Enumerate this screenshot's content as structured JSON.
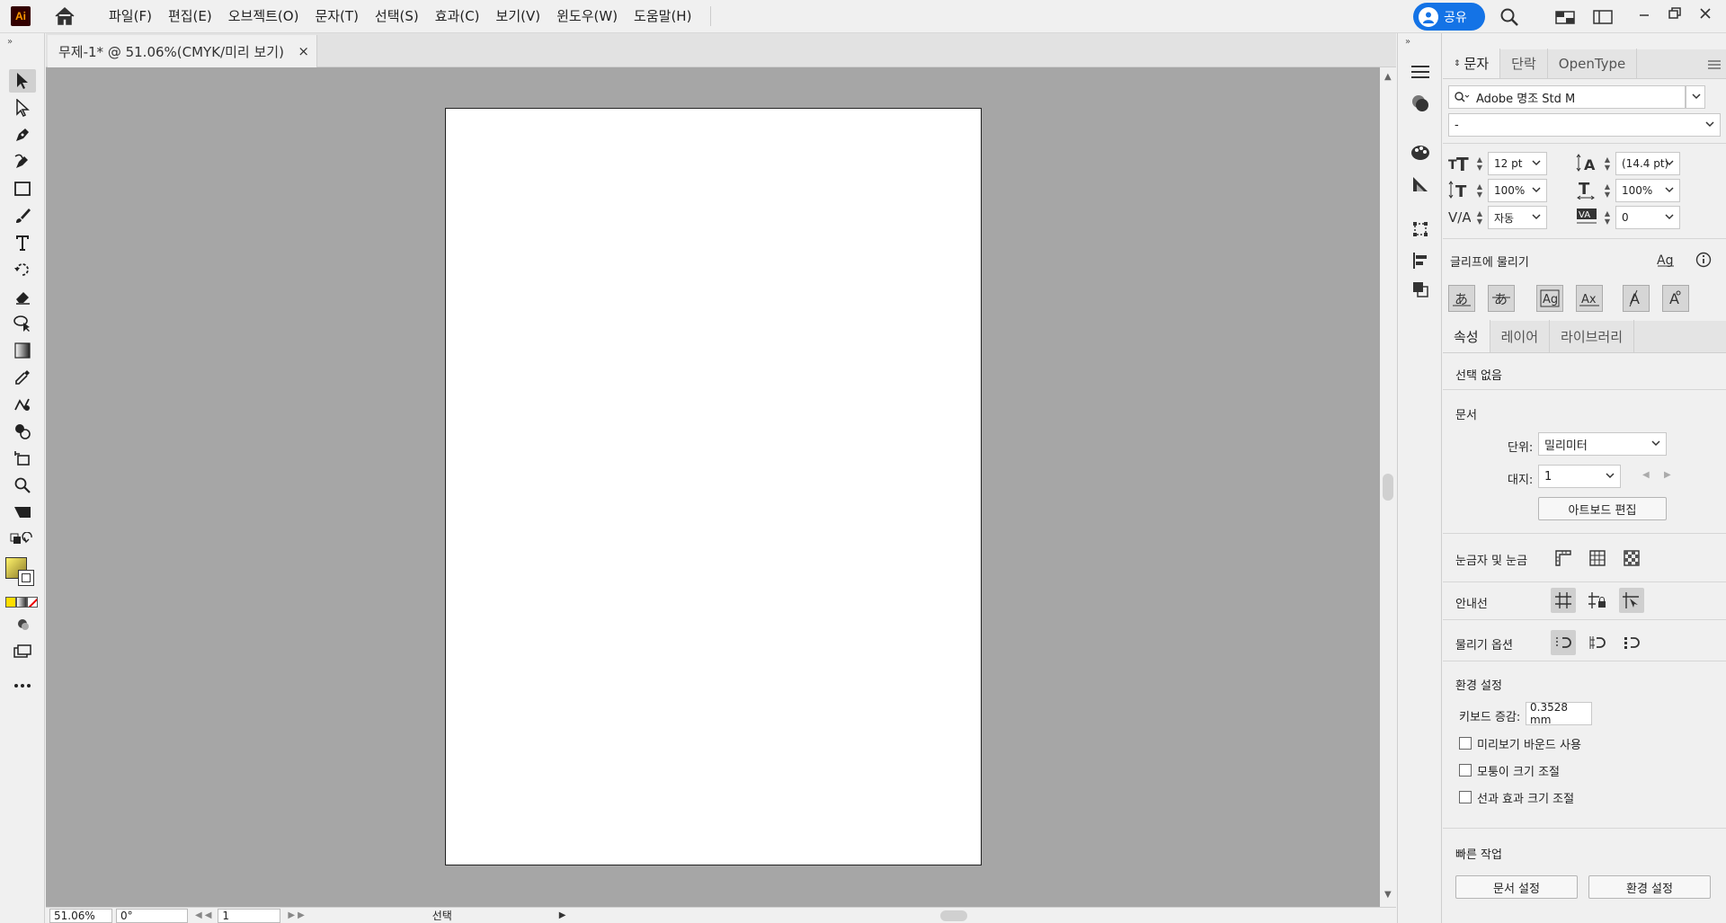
{
  "app": {
    "logo": "Ai"
  },
  "menu": [
    "파일(F)",
    "편집(E)",
    "오브젝트(O)",
    "문자(T)",
    "선택(S)",
    "효과(C)",
    "보기(V)",
    "윈도우(W)",
    "도움말(H)"
  ],
  "share": {
    "label": "공유"
  },
  "document": {
    "tab_title": "무제-1* @ 51.06%(CMYK/미리 보기)",
    "close": "×"
  },
  "status": {
    "zoom": "51.06%",
    "rotation": "0°",
    "artboard": "1",
    "tool": "선택"
  },
  "char_panel": {
    "tabs": [
      "문자",
      "단락",
      "OpenType"
    ],
    "font_family": "Adobe 명조 Std M",
    "font_style": "-",
    "font_size": "12 pt",
    "leading": "(14.4 pt)",
    "vertical_scale": "100%",
    "horizontal_scale": "100%",
    "kerning": "자동",
    "tracking": "0",
    "snap_label": "글리프에 물리기"
  },
  "props_panel": {
    "tabs": [
      "속성",
      "레이어",
      "라이브러리"
    ],
    "no_selection": "선택 없음",
    "document_heading": "문서",
    "units_label": "단위:",
    "units_value": "밀리미터",
    "artboard_label": "대지:",
    "artboard_value": "1",
    "edit_artboard": "아트보드 편집",
    "rulers_label": "눈금자 및 눈금",
    "guides_label": "안내선",
    "snap_options_label": "물리기 옵션",
    "prefs_heading": "환경 설정",
    "keyboard_label": "키보드 증감:",
    "keyboard_value": "0.3528 mm",
    "cb_preview_bounds": "미리보기 바운드 사용",
    "cb_scale_corners": "모퉁이 크기 조절",
    "cb_scale_strokes": "선과 효과 크기 조절",
    "quick_actions": "빠른 작업",
    "doc_setup": "문서 설정",
    "preferences": "환경 설정"
  }
}
